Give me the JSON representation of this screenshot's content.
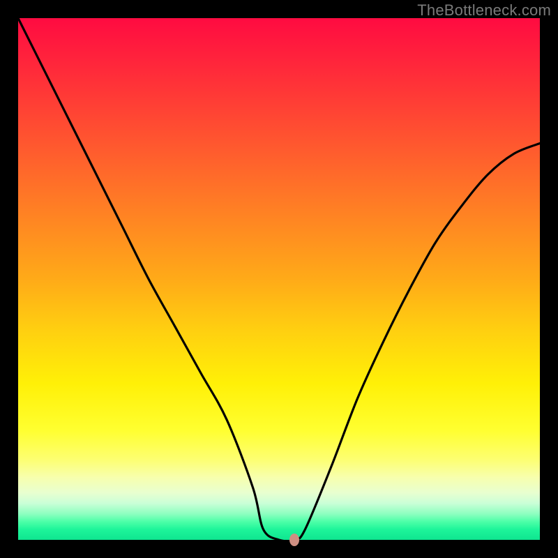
{
  "watermark": "TheBottleneck.com",
  "chart_data": {
    "type": "line",
    "title": "",
    "xlabel": "",
    "ylabel": "",
    "xlim": [
      0,
      1
    ],
    "ylim": [
      0,
      1
    ],
    "series": [
      {
        "name": "curve",
        "x": [
          0.0,
          0.02,
          0.05,
          0.1,
          0.15,
          0.2,
          0.25,
          0.3,
          0.35,
          0.4,
          0.45,
          0.47,
          0.5,
          0.53,
          0.55,
          0.6,
          0.65,
          0.7,
          0.75,
          0.8,
          0.85,
          0.9,
          0.95,
          1.0
        ],
        "y": [
          1.0,
          0.96,
          0.9,
          0.8,
          0.7,
          0.6,
          0.5,
          0.41,
          0.32,
          0.23,
          0.1,
          0.02,
          0.0,
          0.0,
          0.02,
          0.14,
          0.27,
          0.38,
          0.48,
          0.57,
          0.64,
          0.7,
          0.74,
          0.76
        ]
      }
    ],
    "marker": {
      "x": 0.53,
      "y": 0.0
    },
    "background_gradient": {
      "top": "#ff0b41",
      "mid_upper": "#ff8a21",
      "mid": "#fff007",
      "mid_lower": "#fdff70",
      "bottom": "#0fe590"
    }
  }
}
